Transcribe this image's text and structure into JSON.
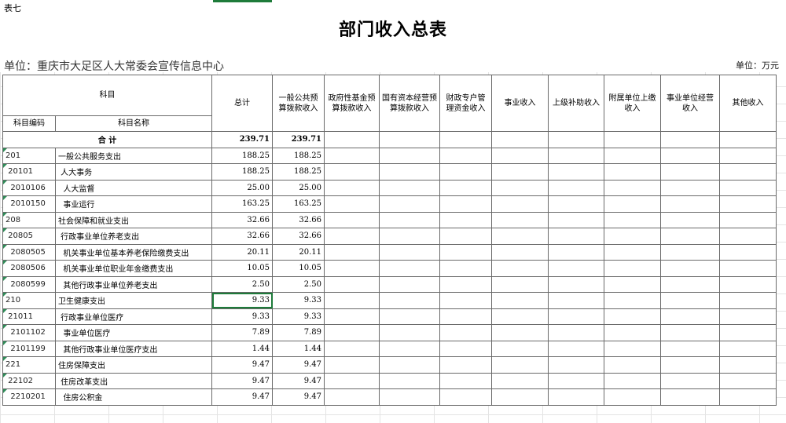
{
  "sheet_label": "表七",
  "title": "部门收入总表",
  "unit_left": "单位：重庆市大足区人大常委会宣传信息中心",
  "unit_right": "单位：万元",
  "headers": {
    "subject": "科目",
    "code": "科目编码",
    "name": "科目名称",
    "total": "总计",
    "general": "一般公共预算拨款收入",
    "fund": "政府性基金预算拨款收入",
    "state_capital": "国有资本经营预算拨款收入",
    "fiscal_account": "财政专户管理资金收入",
    "business": "事业收入",
    "superior": "上级补助收入",
    "affiliated": "附属单位上缴收入",
    "operating": "事业单位经营收入",
    "other": "其他收入"
  },
  "total_row": {
    "label": "合 计",
    "total": "239.71",
    "general": "239.71"
  },
  "rows": [
    {
      "code": "201",
      "name": "一般公共服务支出",
      "total": "188.25",
      "general": "188.25"
    },
    {
      "code": " 20101",
      "name": " 人大事务",
      "total": "188.25",
      "general": "188.25"
    },
    {
      "code": "  2010106",
      "name": "  人大监督",
      "total": "25.00",
      "general": "25.00"
    },
    {
      "code": "  2010150",
      "name": "  事业运行",
      "total": "163.25",
      "general": "163.25"
    },
    {
      "code": "208",
      "name": "社会保障和就业支出",
      "total": "32.66",
      "general": "32.66"
    },
    {
      "code": " 20805",
      "name": " 行政事业单位养老支出",
      "total": "32.66",
      "general": "32.66"
    },
    {
      "code": "  2080505",
      "name": "  机关事业单位基本养老保险缴费支出",
      "total": "20.11",
      "general": "20.11"
    },
    {
      "code": "  2080506",
      "name": "  机关事业单位职业年金缴费支出",
      "total": "10.05",
      "general": "10.05"
    },
    {
      "code": "  2080599",
      "name": "  其他行政事业单位养老支出",
      "total": "2.50",
      "general": "2.50"
    },
    {
      "code": "210",
      "name": "卫生健康支出",
      "total": "9.33",
      "general": "9.33"
    },
    {
      "code": " 21011",
      "name": " 行政事业单位医疗",
      "total": "9.33",
      "general": "9.33"
    },
    {
      "code": "  2101102",
      "name": "  事业单位医疗",
      "total": "7.89",
      "general": "7.89"
    },
    {
      "code": "  2101199",
      "name": "  其他行政事业单位医疗支出",
      "total": "1.44",
      "general": "1.44"
    },
    {
      "code": "221",
      "name": "住房保障支出",
      "total": "9.47",
      "general": "9.47"
    },
    {
      "code": " 22102",
      "name": " 住房改革支出",
      "total": "9.47",
      "general": "9.47"
    },
    {
      "code": "  2210201",
      "name": "  住房公积金",
      "total": "9.47",
      "general": "9.47"
    }
  ]
}
